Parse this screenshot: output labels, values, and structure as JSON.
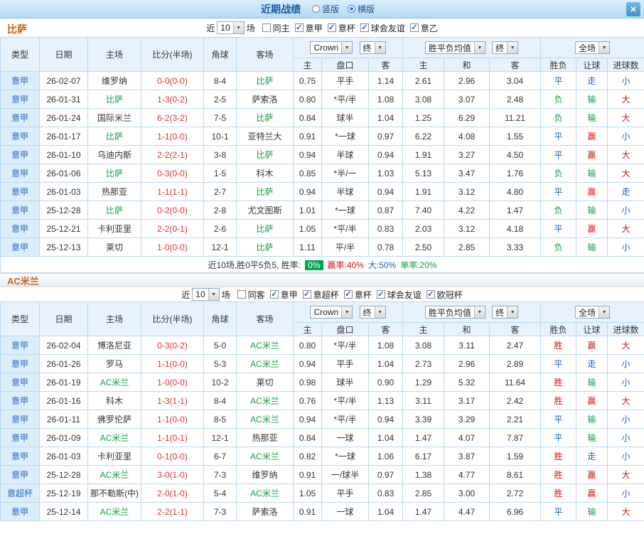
{
  "colors": {
    "topbar_blue": "#b2daf4",
    "title_blue": "#155aa2",
    "team_orange": "#c8651b",
    "league_blue": "#2468c0",
    "focal_green": "#12a041",
    "score_red": "#e03434",
    "win_red": "#e01010",
    "draw_blue": "#1863c8",
    "lose_green": "#12a041",
    "badge_green": "#00a651"
  },
  "icons": {
    "dropdown_arrow": "▼",
    "check": "✓"
  },
  "top_bar": {
    "title": "近期战绩",
    "layout_options": [
      {
        "label": "竖版",
        "selected": false
      },
      {
        "label": "横版",
        "selected": true
      }
    ],
    "close_label": "×"
  },
  "sections": [
    {
      "team": "比萨",
      "filter": {
        "prefix": "近",
        "count": "10",
        "suffix": "场",
        "checkboxes": [
          {
            "label": "同主",
            "checked": false
          },
          {
            "label": "意甲",
            "checked": true
          },
          {
            "label": "意杯",
            "checked": true
          },
          {
            "label": "球会友谊",
            "checked": true
          },
          {
            "label": "意乙",
            "checked": true
          }
        ]
      },
      "dropdowns": {
        "odds_company": "Crown",
        "final1": "终",
        "avg": "胜平负均值",
        "final2": "终",
        "scope": "全场"
      },
      "header": {
        "type": "类型",
        "date": "日期",
        "home": "主场",
        "score": "比分(半场)",
        "corners": "角球",
        "away": "客场",
        "asian_home": "主",
        "handicap": "盘口",
        "asian_away": "客",
        "euro_home": "主",
        "euro_draw": "和",
        "euro_away": "客",
        "result": "胜负",
        "let": "让球",
        "goals": "进球数"
      },
      "rows": [
        {
          "league": "意甲",
          "date": "26-02-07",
          "home": "维罗纳",
          "home_focal": false,
          "score": "0-0(0-0)",
          "corners": "8-4",
          "away": "比萨",
          "away_focal": true,
          "asian_home": "0.75",
          "handicap": "平手",
          "asian_away": "1.14",
          "euro_home": "2.61",
          "euro_draw": "2.96",
          "euro_away": "3.04",
          "result": "平",
          "handicap_result": "走",
          "goals_result": "小"
        },
        {
          "league": "意甲",
          "date": "26-01-31",
          "home": "比萨",
          "home_focal": true,
          "score": "1-3(0-2)",
          "corners": "2-5",
          "away": "萨索洛",
          "away_focal": false,
          "asian_home": "0.80",
          "handicap": "*平/半",
          "asian_away": "1.08",
          "euro_home": "3.08",
          "euro_draw": "3.07",
          "euro_away": "2.48",
          "result": "负",
          "handicap_result": "输",
          "goals_result": "大"
        },
        {
          "league": "意甲",
          "date": "26-01-24",
          "home": "国际米兰",
          "home_focal": false,
          "score": "6-2(3-2)",
          "corners": "7-5",
          "away": "比萨",
          "away_focal": true,
          "asian_home": "0.84",
          "handicap": "球半",
          "asian_away": "1.04",
          "euro_home": "1.25",
          "euro_draw": "6.29",
          "euro_away": "11.21",
          "result": "负",
          "handicap_result": "输",
          "goals_result": "大"
        },
        {
          "league": "意甲",
          "date": "26-01-17",
          "home": "比萨",
          "home_focal": true,
          "score": "1-1(0-0)",
          "corners": "10-1",
          "away": "亚特兰大",
          "away_focal": false,
          "asian_home": "0.91",
          "handicap": "*一球",
          "asian_away": "0.97",
          "euro_home": "6.22",
          "euro_draw": "4.08",
          "euro_away": "1.55",
          "result": "平",
          "handicap_result": "赢",
          "goals_result": "小"
        },
        {
          "league": "意甲",
          "date": "26-01-10",
          "home": "乌迪内斯",
          "home_focal": false,
          "score": "2-2(2-1)",
          "corners": "3-8",
          "away": "比萨",
          "away_focal": true,
          "asian_home": "0.94",
          "handicap": "半球",
          "asian_away": "0.94",
          "euro_home": "1.91",
          "euro_draw": "3.27",
          "euro_away": "4.50",
          "result": "平",
          "handicap_result": "赢",
          "goals_result": "大"
        },
        {
          "league": "意甲",
          "date": "26-01-06",
          "home": "比萨",
          "home_focal": true,
          "score": "0-3(0-0)",
          "corners": "1-5",
          "away": "科木",
          "away_focal": false,
          "asian_home": "0.85",
          "handicap": "*半/一",
          "asian_away": "1.03",
          "euro_home": "5.13",
          "euro_draw": "3.47",
          "euro_away": "1.76",
          "result": "负",
          "handicap_result": "输",
          "goals_result": "大"
        },
        {
          "league": "意甲",
          "date": "26-01-03",
          "home": "热那亚",
          "home_focal": false,
          "score": "1-1(1-1)",
          "corners": "2-7",
          "away": "比萨",
          "away_focal": true,
          "asian_home": "0.94",
          "handicap": "半球",
          "asian_away": "0.94",
          "euro_home": "1.91",
          "euro_draw": "3.12",
          "euro_away": "4.80",
          "result": "平",
          "handicap_result": "赢",
          "goals_result": "走"
        },
        {
          "league": "意甲",
          "date": "25-12-28",
          "home": "比萨",
          "home_focal": true,
          "score": "0-2(0-0)",
          "corners": "2-8",
          "away": "尤文图斯",
          "away_focal": false,
          "asian_home": "1.01",
          "handicap": "*一球",
          "asian_away": "0.87",
          "euro_home": "7.40",
          "euro_draw": "4.22",
          "euro_away": "1.47",
          "result": "负",
          "handicap_result": "输",
          "goals_result": "小"
        },
        {
          "league": "意甲",
          "date": "25-12-21",
          "home": "卡利亚里",
          "home_focal": false,
          "score": "2-2(0-1)",
          "corners": "2-6",
          "away": "比萨",
          "away_focal": true,
          "asian_home": "1.05",
          "handicap": "*平/半",
          "asian_away": "0.83",
          "euro_home": "2.03",
          "euro_draw": "3.12",
          "euro_away": "4.18",
          "result": "平",
          "handicap_result": "赢",
          "goals_result": "大"
        },
        {
          "league": "意甲",
          "date": "25-12-13",
          "home": "莱切",
          "home_focal": false,
          "score": "1-0(0-0)",
          "corners": "12-1",
          "away": "比萨",
          "away_focal": true,
          "asian_home": "1.11",
          "handicap": "平/半",
          "asian_away": "0.78",
          "euro_home": "2.50",
          "euro_draw": "2.85",
          "euro_away": "3.33",
          "result": "负",
          "handicap_result": "输",
          "goals_result": "小"
        }
      ],
      "summary": {
        "prefix": "近10场,胜0平5负5, 胜率:",
        "win_rate": "0%",
        "asian_rate": "赢率:40%",
        "big_rate": "大:50%",
        "odd_rate": "单率:20%"
      }
    },
    {
      "team": "AC米兰",
      "filter": {
        "prefix": "近",
        "count": "10",
        "suffix": "场",
        "checkboxes": [
          {
            "label": "同客",
            "checked": false
          },
          {
            "label": "意甲",
            "checked": true
          },
          {
            "label": "意超杯",
            "checked": true
          },
          {
            "label": "意杯",
            "checked": true
          },
          {
            "label": "球会友谊",
            "checked": true
          },
          {
            "label": "欧冠杯",
            "checked": true
          }
        ]
      },
      "dropdowns": {
        "odds_company": "Crown",
        "final1": "终",
        "avg": "胜平负均值",
        "final2": "终",
        "scope": "全场"
      },
      "header": {
        "type": "类型",
        "date": "日期",
        "home": "主场",
        "score": "比分(半场)",
        "corners": "角球",
        "away": "客场",
        "asian_home": "主",
        "handicap": "盘口",
        "asian_away": "客",
        "euro_home": "主",
        "euro_draw": "和",
        "euro_away": "客",
        "result": "胜负",
        "let": "让球",
        "goals": "进球数"
      },
      "rows": [
        {
          "league": "意甲",
          "date": "26-02-04",
          "home": "博洛尼亚",
          "home_focal": false,
          "score": "0-3(0-2)",
          "corners": "5-0",
          "away": "AC米兰",
          "away_focal": true,
          "asian_home": "0.80",
          "handicap": "*平/半",
          "asian_away": "1.08",
          "euro_home": "3.08",
          "euro_draw": "3.11",
          "euro_away": "2.47",
          "result": "胜",
          "handicap_result": "赢",
          "goals_result": "大"
        },
        {
          "league": "意甲",
          "date": "26-01-26",
          "home": "罗马",
          "home_focal": false,
          "score": "1-1(0-0)",
          "corners": "5-3",
          "away": "AC米兰",
          "away_focal": true,
          "asian_home": "0.94",
          "handicap": "平手",
          "asian_away": "1.04",
          "euro_home": "2.73",
          "euro_draw": "2.96",
          "euro_away": "2.89",
          "result": "平",
          "handicap_result": "走",
          "goals_result": "小"
        },
        {
          "league": "意甲",
          "date": "26-01-19",
          "home": "AC米兰",
          "home_focal": true,
          "score": "1-0(0-0)",
          "corners": "10-2",
          "away": "莱切",
          "away_focal": false,
          "asian_home": "0.98",
          "handicap": "球半",
          "asian_away": "0.90",
          "euro_home": "1.29",
          "euro_draw": "5.32",
          "euro_away": "11.64",
          "result": "胜",
          "handicap_result": "输",
          "goals_result": "小"
        },
        {
          "league": "意甲",
          "date": "26-01-16",
          "home": "科木",
          "home_focal": false,
          "score": "1-3(1-1)",
          "corners": "8-4",
          "away": "AC米兰",
          "away_focal": true,
          "asian_home": "0.76",
          "handicap": "*平/半",
          "asian_away": "1.13",
          "euro_home": "3.11",
          "euro_draw": "3.17",
          "euro_away": "2.42",
          "result": "胜",
          "handicap_result": "赢",
          "goals_result": "大"
        },
        {
          "league": "意甲",
          "date": "26-01-11",
          "home": "佛罗伦萨",
          "home_focal": false,
          "score": "1-1(0-0)",
          "corners": "8-5",
          "away": "AC米兰",
          "away_focal": true,
          "asian_home": "0.94",
          "handicap": "*平/半",
          "asian_away": "0.94",
          "euro_home": "3.39",
          "euro_draw": "3.29",
          "euro_away": "2.21",
          "result": "平",
          "handicap_result": "输",
          "goals_result": "小"
        },
        {
          "league": "意甲",
          "date": "26-01-09",
          "home": "AC米兰",
          "home_focal": true,
          "score": "1-1(0-1)",
          "corners": "12-1",
          "away": "热那亚",
          "away_focal": false,
          "asian_home": "0.84",
          "handicap": "一球",
          "asian_away": "1.04",
          "euro_home": "1.47",
          "euro_draw": "4.07",
          "euro_away": "7.87",
          "result": "平",
          "handicap_result": "输",
          "goals_result": "小"
        },
        {
          "league": "意甲",
          "date": "26-01-03",
          "home": "卡利亚里",
          "home_focal": false,
          "score": "0-1(0-0)",
          "corners": "6-7",
          "away": "AC米兰",
          "away_focal": true,
          "asian_home": "0.82",
          "handicap": "*一球",
          "asian_away": "1.06",
          "euro_home": "6.17",
          "euro_draw": "3.87",
          "euro_away": "1.59",
          "result": "胜",
          "handicap_result": "走",
          "goals_result": "小"
        },
        {
          "league": "意甲",
          "date": "25-12-28",
          "home": "AC米兰",
          "home_focal": true,
          "score": "3-0(1-0)",
          "corners": "7-3",
          "away": "维罗纳",
          "away_focal": false,
          "asian_home": "0.91",
          "handicap": "一/球半",
          "asian_away": "0.97",
          "euro_home": "1.38",
          "euro_draw": "4.77",
          "euro_away": "8.61",
          "result": "胜",
          "handicap_result": "赢",
          "goals_result": "大"
        },
        {
          "league": "意超杯",
          "date": "25-12-19",
          "home": "那不勒斯(中)",
          "home_focal": false,
          "score": "2-0(1-0)",
          "corners": "5-4",
          "away": "AC米兰",
          "away_focal": true,
          "asian_home": "1.05",
          "handicap": "平手",
          "asian_away": "0.83",
          "euro_home": "2.85",
          "euro_draw": "3.00",
          "euro_away": "2.72",
          "result": "胜",
          "handicap_result": "赢",
          "goals_result": "小"
        },
        {
          "league": "意甲",
          "date": "25-12-14",
          "home": "AC米兰",
          "home_focal": true,
          "score": "2-2(1-1)",
          "corners": "7-3",
          "away": "萨索洛",
          "away_focal": false,
          "asian_home": "0.91",
          "handicap": "一球",
          "asian_away": "1.04",
          "euro_home": "1.47",
          "euro_draw": "4.47",
          "euro_away": "6.96",
          "result": "平",
          "handicap_result": "输",
          "goals_result": "大"
        }
      ]
    }
  ]
}
